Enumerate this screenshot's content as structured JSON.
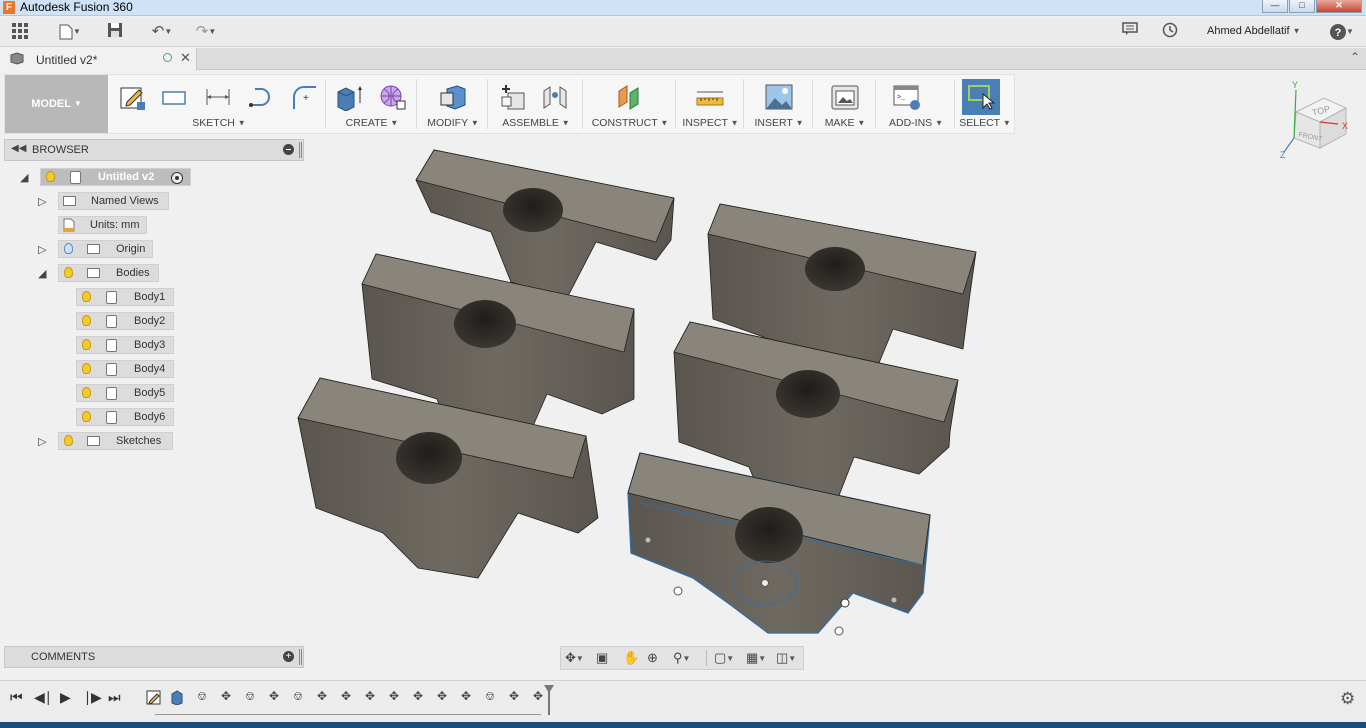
{
  "window": {
    "title": "Autodesk Fusion 360",
    "logo": "F"
  },
  "quickaccess": {
    "icons": [
      "grid-icon",
      "file-icon",
      "save-icon",
      "undo-icon",
      "redo-icon"
    ],
    "user": "Ahmed Abdellatif"
  },
  "document": {
    "tab_name": "Untitled v2*"
  },
  "toolbar": {
    "workspace": "MODEL",
    "groups": [
      "SKETCH",
      "CREATE",
      "MODIFY",
      "ASSEMBLE",
      "CONSTRUCT",
      "INSPECT",
      "INSERT",
      "MAKE",
      "ADD-INS",
      "SELECT"
    ]
  },
  "viewcube": {
    "top": "TOP",
    "front": "FRONT",
    "x": "X",
    "y": "Y",
    "z": "Z"
  },
  "browser": {
    "title": "BROWSER",
    "root": "Untitled v2",
    "items": [
      "Named Views",
      "Units: mm",
      "Origin",
      "Bodies",
      "Sketches"
    ],
    "bodies": [
      "Body1",
      "Body2",
      "Body3",
      "Body4",
      "Body5",
      "Body6"
    ]
  },
  "comments": {
    "title": "COMMENTS"
  },
  "colors": {
    "accent": "#4a7fb5",
    "part_top": "#8a857a",
    "part_side": "#65615a",
    "select_blue": "#2e6fa8"
  }
}
